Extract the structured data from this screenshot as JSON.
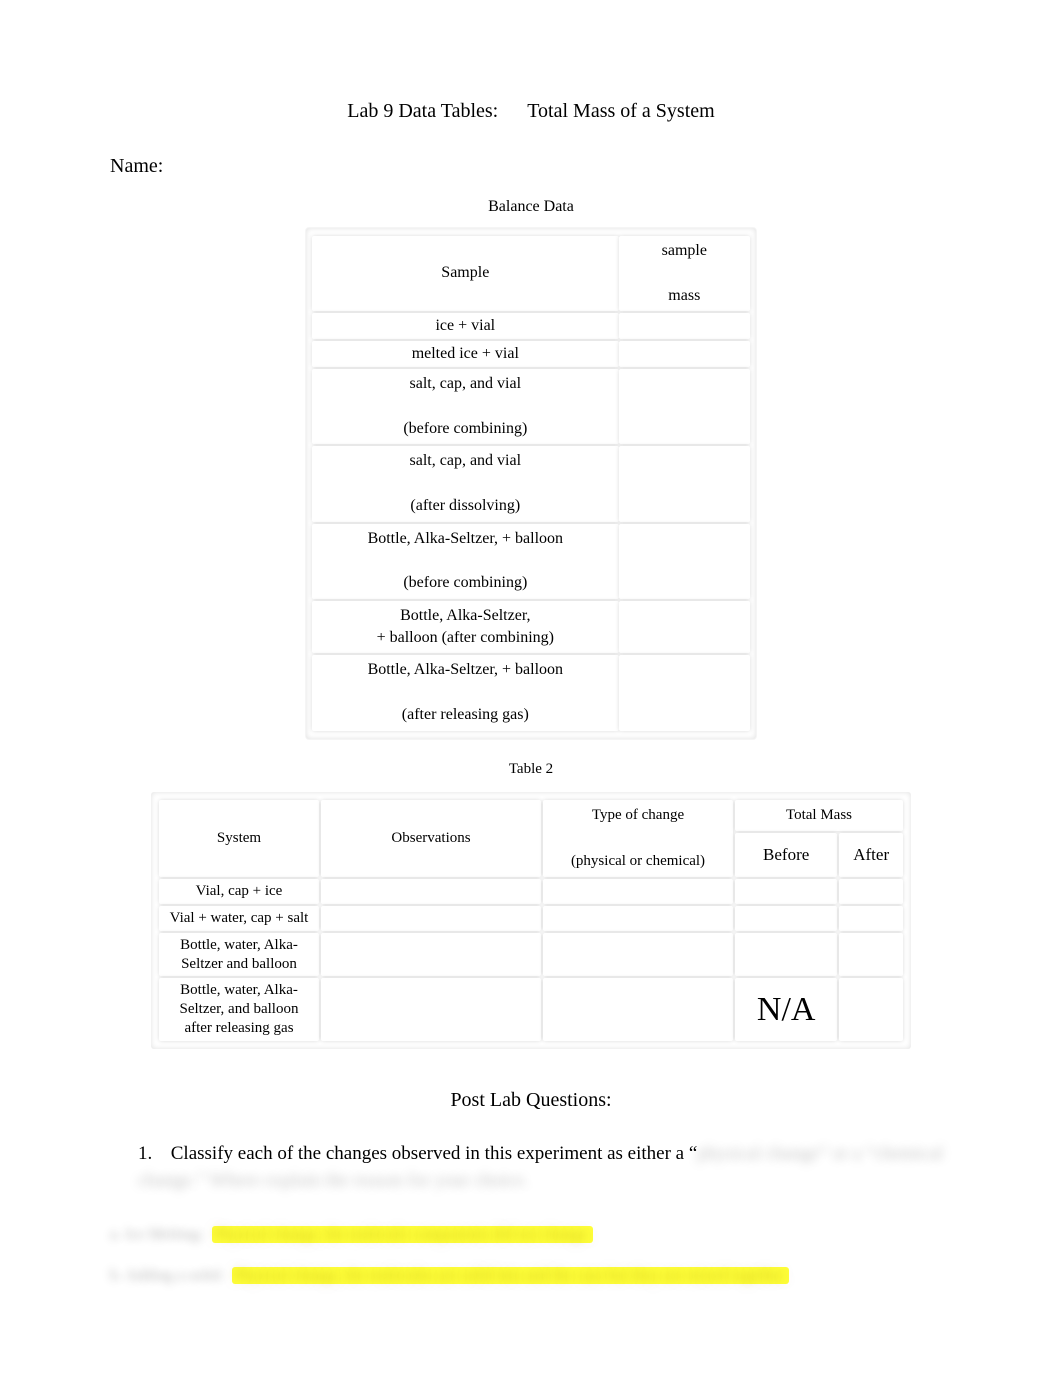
{
  "title": {
    "left": "Lab 9 Data Tables:",
    "right": "Total Mass of a System"
  },
  "name_label": "Name:",
  "balance": {
    "caption": "Balance Data",
    "headers": {
      "sample": "Sample",
      "mass_line1": "sample",
      "mass_line2": "mass"
    },
    "rows": [
      {
        "sample_l1": "ice + vial",
        "sample_l2": "",
        "mass": ""
      },
      {
        "sample_l1": "melted ice + vial",
        "sample_l2": "",
        "mass": ""
      },
      {
        "sample_l1": "salt, cap, and vial",
        "sample_l2": "(before combining)",
        "mass": ""
      },
      {
        "sample_l1": "salt, cap, and vial",
        "sample_l2": "(after dissolving)",
        "mass": ""
      },
      {
        "sample_l1": "Bottle, Alka-Seltzer, + balloon",
        "sample_l2": "(before combining)",
        "mass": ""
      },
      {
        "sample_l1": "Bottle, Alka-Seltzer,",
        "sample_l2": "+ balloon (after combining)",
        "mass": ""
      },
      {
        "sample_l1": "Bottle, Alka-Seltzer, + balloon",
        "sample_l2": "(after releasing gas)",
        "mass": ""
      }
    ]
  },
  "table2": {
    "caption": "Table 2",
    "headers": {
      "system": "System",
      "observations": "Observations",
      "type_l1": "Type of change",
      "type_l2": "(physical or chemical)",
      "totalmass": "Total Mass",
      "before": "Before",
      "after": "After"
    },
    "rows": [
      {
        "system": "Vial, cap + ice",
        "obs": "",
        "type": "",
        "before": "",
        "after": ""
      },
      {
        "system": "Vial + water, cap + salt",
        "obs": "",
        "type": "",
        "before": "",
        "after": ""
      },
      {
        "system_l1": "Bottle, water, Alka-",
        "system_l2": "Seltzer and balloon",
        "obs": "",
        "type": "",
        "before": "",
        "after": ""
      },
      {
        "system_l1": "Bottle, water, Alka-",
        "system_l2": "Seltzer, and balloon",
        "system_l3": "after releasing gas",
        "obs": "",
        "type": "",
        "before": "N/A",
        "after": ""
      }
    ]
  },
  "postlab": {
    "heading": "Post Lab Questions:",
    "q1_num": "1.",
    "q1_visible": "Classify each of the changes observed in this experiment as either a “",
    "q1_hidden_tail": "physical change” or a “chemical change.”  Where  explain  the  reason  for  your  choice.",
    "a1_lead": "a. Ice Melting:  ",
    "a1_hl": "Physical change, the molecule components did not change.",
    "a2_lead": "b. Adding a solid:  ",
    "a2_hl": "Physical change, the molecules are  solid into  and the  case  but they are mixed  together."
  }
}
